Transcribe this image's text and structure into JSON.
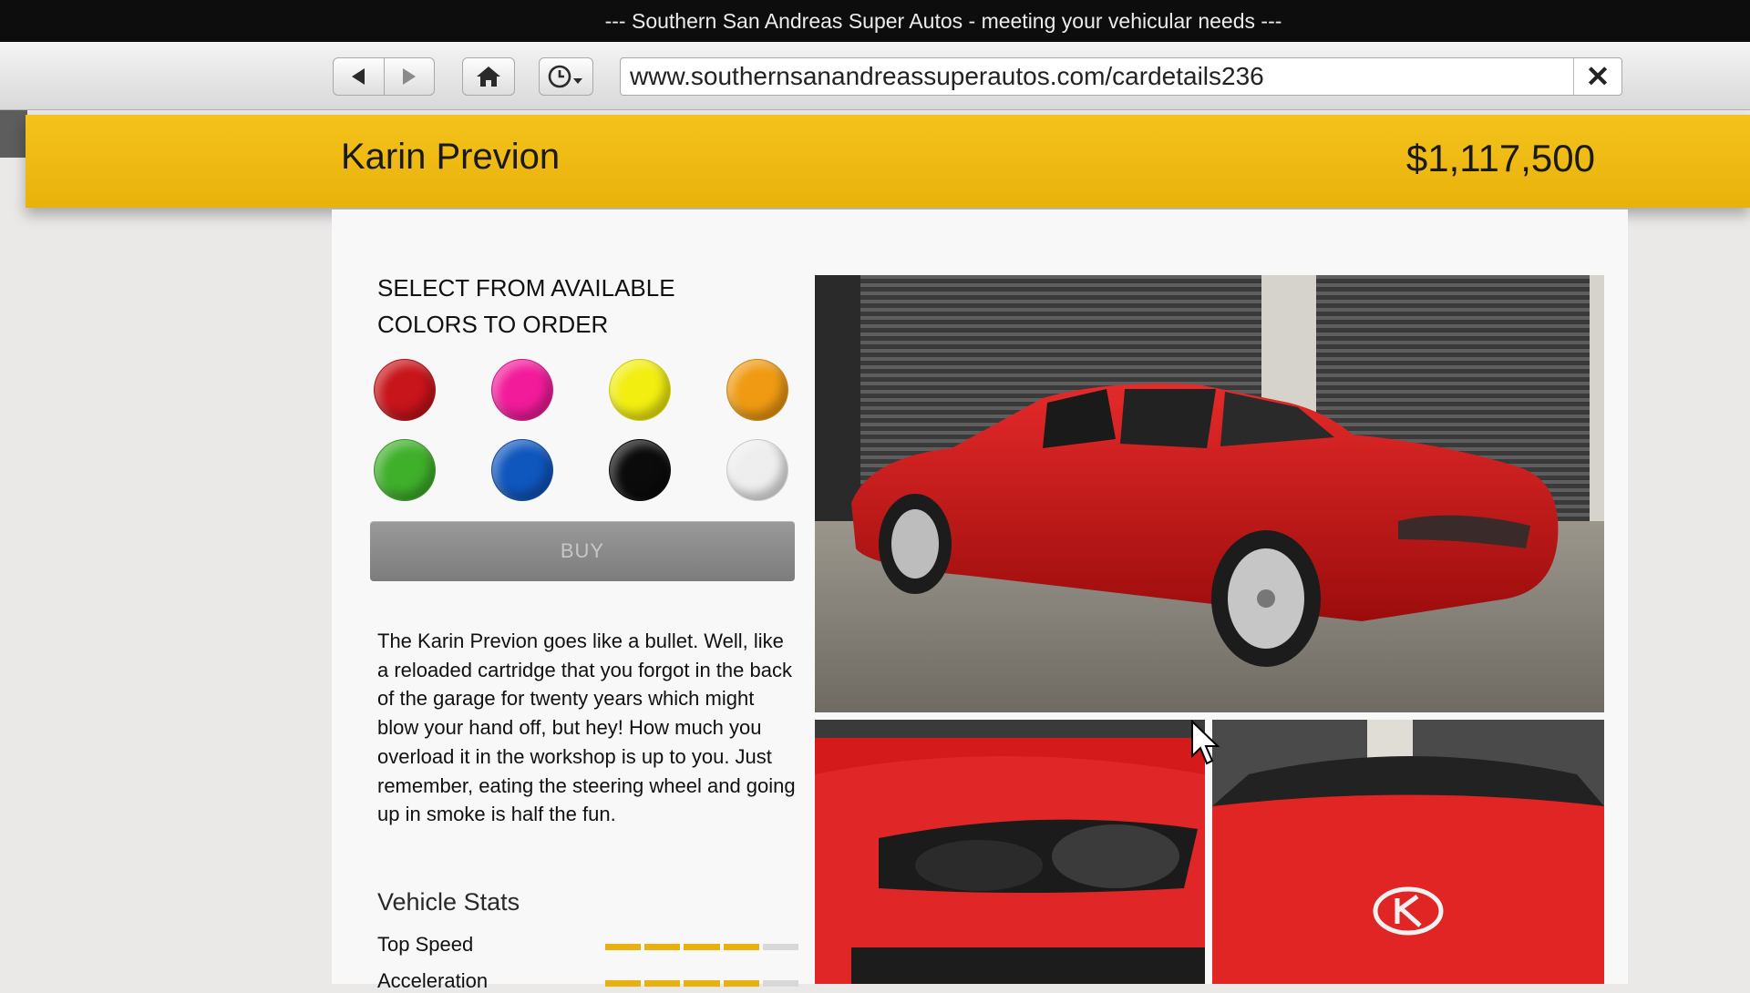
{
  "window": {
    "title": "--- Southern San Andreas Super Autos - meeting your vehicular needs ---"
  },
  "browser": {
    "url": "www.southernsanandreassuperautos.com/cardetails236",
    "icons": {
      "back": "back-arrow-icon",
      "forward": "forward-arrow-icon",
      "home": "home-icon",
      "history": "history-clock-icon",
      "close": "close-icon"
    }
  },
  "vehicle": {
    "name": "Karin Previon",
    "price": "$1,117,500"
  },
  "color_picker": {
    "heading": "SELECT FROM AVAILABLE COLORS TO ORDER",
    "colors": [
      "#c8141b",
      "#f21b9a",
      "#f2ee10",
      "#ef9a12",
      "#3fb02a",
      "#0f56bd",
      "#0b0b0b",
      "#eeeeee"
    ]
  },
  "buy_label": "BUY",
  "description": "The Karin Previon goes like a bullet. Well, like a reloaded cartridge that you forgot in the back of the garage for twenty years which might blow your hand off, but hey! How much you overload it in the workshop is up to you. Just remember, eating the steering wheel and going up in smoke is half the fun.",
  "stats": {
    "heading": "Vehicle Stats",
    "items": [
      {
        "label": "Top Speed",
        "filled": 4,
        "total": 5
      },
      {
        "label": "Acceleration",
        "filled": 4,
        "total": 5
      }
    ],
    "colors": {
      "filled": "#e9b10f",
      "empty": "#d8d8d8"
    }
  },
  "gallery": {
    "items": [
      "car-photo-main",
      "car-photo-headlight",
      "car-photo-hood-emblem"
    ]
  }
}
